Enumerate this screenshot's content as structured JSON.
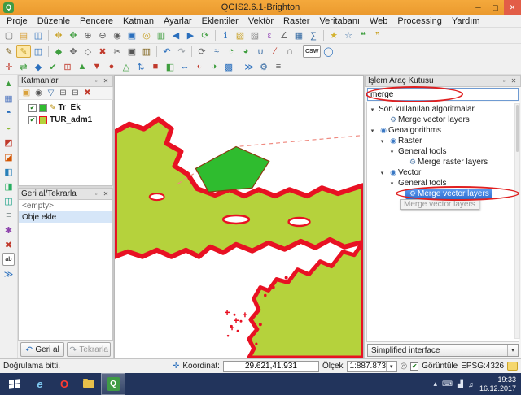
{
  "colors": {
    "titlebar": "#f4a93c",
    "land": "#b5d23c",
    "border": "#e81123",
    "polygon": "#2fbc2f",
    "selection": "#3c80df",
    "taskbar": "#22345c",
    "annotation": "#e02020"
  },
  "titlebar": {
    "title": "QGIS2.6.1-Brighton"
  },
  "menubar": {
    "items": [
      "Proje",
      "Düzenle",
      "Pencere",
      "Katman",
      "Ayarlar",
      "Eklentiler",
      "Vektör",
      "Raster",
      "Veritabanı",
      "Web",
      "Processing",
      "Yardım"
    ]
  },
  "toolbar_row1": [
    {
      "n": "new-project-icon",
      "g": "▢",
      "c": "#6b6b6b"
    },
    {
      "n": "open-project-icon",
      "g": "▤",
      "c": "#d9a13b"
    },
    {
      "n": "save-project-icon",
      "g": "◫",
      "c": "#2a6fbd"
    },
    {
      "sep": true
    },
    {
      "n": "pan-map-icon",
      "g": "✥",
      "c": "#c9a227"
    },
    {
      "n": "pan-to-selection-icon",
      "g": "✥",
      "c": "#3f9e3f"
    },
    {
      "n": "zoom-in-icon",
      "g": "⊕",
      "c": "#5f5f5f"
    },
    {
      "n": "zoom-out-icon",
      "g": "⊖",
      "c": "#5f5f5f"
    },
    {
      "n": "zoom-native-icon",
      "g": "◉",
      "c": "#5f5f5f"
    },
    {
      "n": "zoom-full-icon",
      "g": "▣",
      "c": "#2a6fbd"
    },
    {
      "n": "zoom-to-selection-icon",
      "g": "◎",
      "c": "#c9a227"
    },
    {
      "n": "zoom-to-layer-icon",
      "g": "▥",
      "c": "#3f9e3f"
    },
    {
      "n": "zoom-last-icon",
      "g": "◀",
      "c": "#2a6fbd"
    },
    {
      "n": "zoom-next-icon",
      "g": "▶",
      "c": "#2a6fbd"
    },
    {
      "n": "refresh-map-icon",
      "g": "⟳",
      "c": "#3f9e3f"
    },
    {
      "sep": true
    },
    {
      "n": "identify-features-icon",
      "g": "ℹ",
      "c": "#2a6fbd"
    },
    {
      "n": "select-features-icon",
      "g": "▧",
      "c": "#c9a227"
    },
    {
      "n": "deselect-features-icon",
      "g": "▨",
      "c": "#8a8a8a"
    },
    {
      "n": "select-by-expression-icon",
      "g": "ε",
      "c": "#9e5abd"
    },
    {
      "n": "measure-line-icon",
      "g": "∠",
      "c": "#6b6b6b"
    },
    {
      "n": "attribute-table-icon",
      "g": "▦",
      "c": "#3a6ea5"
    },
    {
      "n": "field-calculator-icon",
      "g": "∑",
      "c": "#3a6ea5"
    },
    {
      "sep": true
    },
    {
      "n": "new-bookmark-icon",
      "g": "★",
      "c": "#d3b22f"
    },
    {
      "n": "show-bookmarks-icon",
      "g": "☆",
      "c": "#3a6ea5"
    },
    {
      "n": "map-tips-icon",
      "g": "❝",
      "c": "#3f9e3f"
    },
    {
      "n": "annotation-icon",
      "g": "❞",
      "c": "#c9a227"
    }
  ],
  "toolbar_row2": [
    {
      "n": "current-edits-icon",
      "g": "✎",
      "c": "#7a5c12"
    },
    {
      "n": "toggle-editing-icon",
      "g": "✎",
      "c": "#c9a227",
      "active": true
    },
    {
      "n": "save-layer-edits-icon",
      "g": "◫",
      "c": "#2a6fbd"
    },
    {
      "sep": true
    },
    {
      "n": "add-feature-icon",
      "g": "◆",
      "c": "#3f9e3f"
    },
    {
      "n": "move-feature-icon",
      "g": "✥",
      "c": "#6b6b6b"
    },
    {
      "n": "node-tool-icon",
      "g": "◇",
      "c": "#6b6b6b"
    },
    {
      "n": "delete-selected-icon",
      "g": "✖",
      "c": "#c0392b"
    },
    {
      "n": "cut-features-icon",
      "g": "✂",
      "c": "#555555"
    },
    {
      "n": "copy-features-icon",
      "g": "▣",
      "c": "#555555"
    },
    {
      "n": "paste-features-icon",
      "g": "▥",
      "c": "#7a5c12"
    },
    {
      "sep": true
    },
    {
      "n": "undo-icon",
      "g": "↶",
      "c": "#2a6fbd"
    },
    {
      "n": "redo-icon",
      "g": "↷",
      "c": "#9aa0a6"
    },
    {
      "sep": true
    },
    {
      "n": "rotate-feature-icon",
      "g": "⟳",
      "c": "#6b6b6b"
    },
    {
      "n": "simplify-feature-icon",
      "g": "≈",
      "c": "#3a6ea5"
    },
    {
      "n": "add-ring-icon",
      "g": "◔",
      "c": "#3f9e3f"
    },
    {
      "n": "add-part-icon",
      "g": "◕",
      "c": "#3f9e3f"
    },
    {
      "n": "merge-features-icon",
      "g": "∪",
      "c": "#3a6ea5"
    },
    {
      "n": "split-features-icon",
      "g": "∕",
      "c": "#c0392b"
    },
    {
      "n": "reshape-features-icon",
      "g": "∩",
      "c": "#6b6b6b"
    },
    {
      "sep": true
    },
    {
      "n": "csw-search-button",
      "g": "CSW",
      "text": true,
      "c": "#333333"
    },
    {
      "n": "metasearch-icon",
      "g": "◯",
      "c": "#2a6fbd"
    }
  ],
  "toolbar_row3": [
    {
      "n": "coordinate-capture-icon",
      "g": "✛",
      "c": "#c0392b"
    },
    {
      "n": "dxf2shp-converter-icon",
      "g": "⇄",
      "c": "#3f9e3f"
    },
    {
      "n": "evis-icon",
      "g": "◆",
      "c": "#2a6fbd"
    },
    {
      "n": "geometry-checker-icon",
      "g": "✔",
      "c": "#3f9e3f"
    },
    {
      "n": "georeferencer-icon",
      "g": "⊞",
      "c": "#c0392b"
    },
    {
      "n": "gps-tools-icon",
      "g": "▲",
      "c": "#3f9e3f"
    },
    {
      "n": "grass-tools-icon",
      "g": "▼",
      "c": "#c0392b"
    },
    {
      "n": "heatmap-icon",
      "g": "●",
      "c": "#c0392b"
    },
    {
      "n": "interpolation-icon",
      "g": "△",
      "c": "#3f9e3f"
    },
    {
      "n": "offline-editing-icon",
      "g": "⇅",
      "c": "#2a6fbd"
    },
    {
      "n": "oracle-georaster-icon",
      "g": "■",
      "c": "#c0392b"
    },
    {
      "n": "raster-terrain-analysis-icon",
      "g": "◧",
      "c": "#3f9e3f"
    },
    {
      "n": "road-graph-icon",
      "g": "↔",
      "c": "#2a6fbd"
    },
    {
      "n": "spatial-query-icon",
      "g": "◐",
      "c": "#c0392b"
    },
    {
      "n": "topology-checker-icon",
      "g": "◑",
      "c": "#3f9e3f"
    },
    {
      "n": "zonal-statistics-icon",
      "g": "▩",
      "c": "#2a6fbd"
    },
    {
      "sep": true
    },
    {
      "n": "python-console-icon",
      "g": "≫",
      "c": "#2a6fbd"
    },
    {
      "n": "processing-toolbox-icon",
      "g": "⚙",
      "c": "#3a6ea5"
    },
    {
      "n": "processing-history-icon",
      "g": "≡",
      "c": "#6b6b6b"
    }
  ],
  "left_toolbar": [
    {
      "n": "add-vector-layer-icon",
      "g": "▲",
      "c": "#3f9e3f"
    },
    {
      "n": "add-raster-layer-icon",
      "g": "▦",
      "c": "#5a7ec2"
    },
    {
      "n": "add-postgis-layer-icon",
      "g": "◓",
      "c": "#2a6fbd"
    },
    {
      "n": "add-spatialite-layer-icon",
      "g": "◒",
      "c": "#8ab633"
    },
    {
      "n": "add-mssql-layer-icon",
      "g": "◩",
      "c": "#c0392b"
    },
    {
      "n": "add-oracle-layer-icon",
      "g": "◪",
      "c": "#d35400"
    },
    {
      "n": "add-wms-layer-icon",
      "g": "◧",
      "c": "#2980b9"
    },
    {
      "n": "add-wcs-layer-icon",
      "g": "◨",
      "c": "#27ae60"
    },
    {
      "n": "add-wfs-layer-icon",
      "g": "◫",
      "c": "#16a085"
    },
    {
      "n": "add-delimited-text-icon",
      "g": "≡",
      "c": "#7f8c8d"
    },
    {
      "n": "new-shapefile-layer-icon",
      "g": "✱",
      "c": "#8e44ad"
    },
    {
      "n": "remove-layer-icon",
      "g": "✖",
      "c": "#c0392b"
    },
    {
      "n": "label-tool-icon",
      "g": "ab",
      "text": true,
      "c": "#333333"
    },
    {
      "n": "python-console-icon",
      "g": "≫",
      "c": "#2a6fbd"
    }
  ],
  "layers_panel": {
    "title": "Katmanlar",
    "tools": [
      {
        "n": "add-group-icon",
        "g": "▣",
        "c": "#d9a13b"
      },
      {
        "n": "manage-visibility-icon",
        "g": "◉",
        "c": "#555555"
      },
      {
        "n": "filter-legend-icon",
        "g": "▽",
        "c": "#3a6ea5"
      },
      {
        "n": "expand-all-icon",
        "g": "⊞",
        "c": "#555555"
      },
      {
        "n": "collapse-all-icon",
        "g": "⊟",
        "c": "#555555"
      },
      {
        "n": "remove-layer-icon",
        "g": "✖",
        "c": "#c0392b"
      }
    ],
    "layers": [
      {
        "label": "Tr_Ek_",
        "checked": true,
        "editing": true,
        "swatch": "#2fbc2f"
      },
      {
        "label": "TUR_adm1",
        "checked": true,
        "swatch": "#b5d23c",
        "swatch_border": "#e81123"
      }
    ]
  },
  "undo_panel": {
    "title": "Geri al/Tekrarla",
    "items": [
      {
        "label": "<empty>",
        "muted": true
      },
      {
        "label": "Obje ekle",
        "selected": true
      }
    ],
    "undo_label": "Geri al",
    "redo_label": "Tekrarla"
  },
  "processing_panel": {
    "title": "İşlem Araç Kutusu",
    "search_value": "merge",
    "tree": [
      {
        "label": "Son kullanılan algoritmalar",
        "depth": 0,
        "expanded": true
      },
      {
        "label": "Merge vector layers",
        "depth": 1,
        "icon": "gear"
      },
      {
        "label": "Geoalgorithms",
        "depth": 0,
        "expanded": true,
        "icon": "group"
      },
      {
        "label": "Raster",
        "depth": 1,
        "expanded": true,
        "icon": "group"
      },
      {
        "label": "General tools",
        "depth": 2,
        "expanded": true
      },
      {
        "label": "Merge raster layers",
        "depth": 3,
        "icon": "gear"
      },
      {
        "label": "Vector",
        "depth": 1,
        "expanded": true,
        "icon": "group"
      },
      {
        "label": "General tools",
        "depth": 2,
        "expanded": true
      },
      {
        "label": "Merge vector layers",
        "depth": 3,
        "icon": "gear",
        "selected": true
      },
      {
        "label": "Merge vector layers",
        "tooltip": true
      }
    ],
    "footer_value": "Simplified interface"
  },
  "statusbar": {
    "message": "Doğrulama bitti.",
    "coordinate_label": "Koordinat:",
    "coordinate_value": "29.621,41.931",
    "scale_label": "Ölçek",
    "scale_value": "1:887.873",
    "render_label": "Görüntüle",
    "render_checked": true,
    "epsg_label": "EPSG:4326"
  },
  "taskbar": {
    "apps": [
      {
        "n": "start-button",
        "type": "start"
      },
      {
        "n": "internet-explorer-icon",
        "g": "e",
        "c": "#7ec9f2",
        "italic": true
      },
      {
        "n": "opera-icon",
        "g": "O",
        "c": "#ff3b30"
      },
      {
        "n": "file-explorer-icon",
        "type": "folder"
      },
      {
        "n": "qgis-taskbar-icon",
        "type": "qgis",
        "active": true
      }
    ],
    "tray": [
      {
        "n": "tray-expand-icon",
        "g": "▴"
      },
      {
        "n": "touch-keyboard-icon",
        "g": "⌨"
      },
      {
        "n": "network-icon",
        "g": "▟"
      },
      {
        "n": "volume-icon",
        "g": "♬"
      }
    ],
    "time": "19:33",
    "date": "16.12.2017"
  }
}
